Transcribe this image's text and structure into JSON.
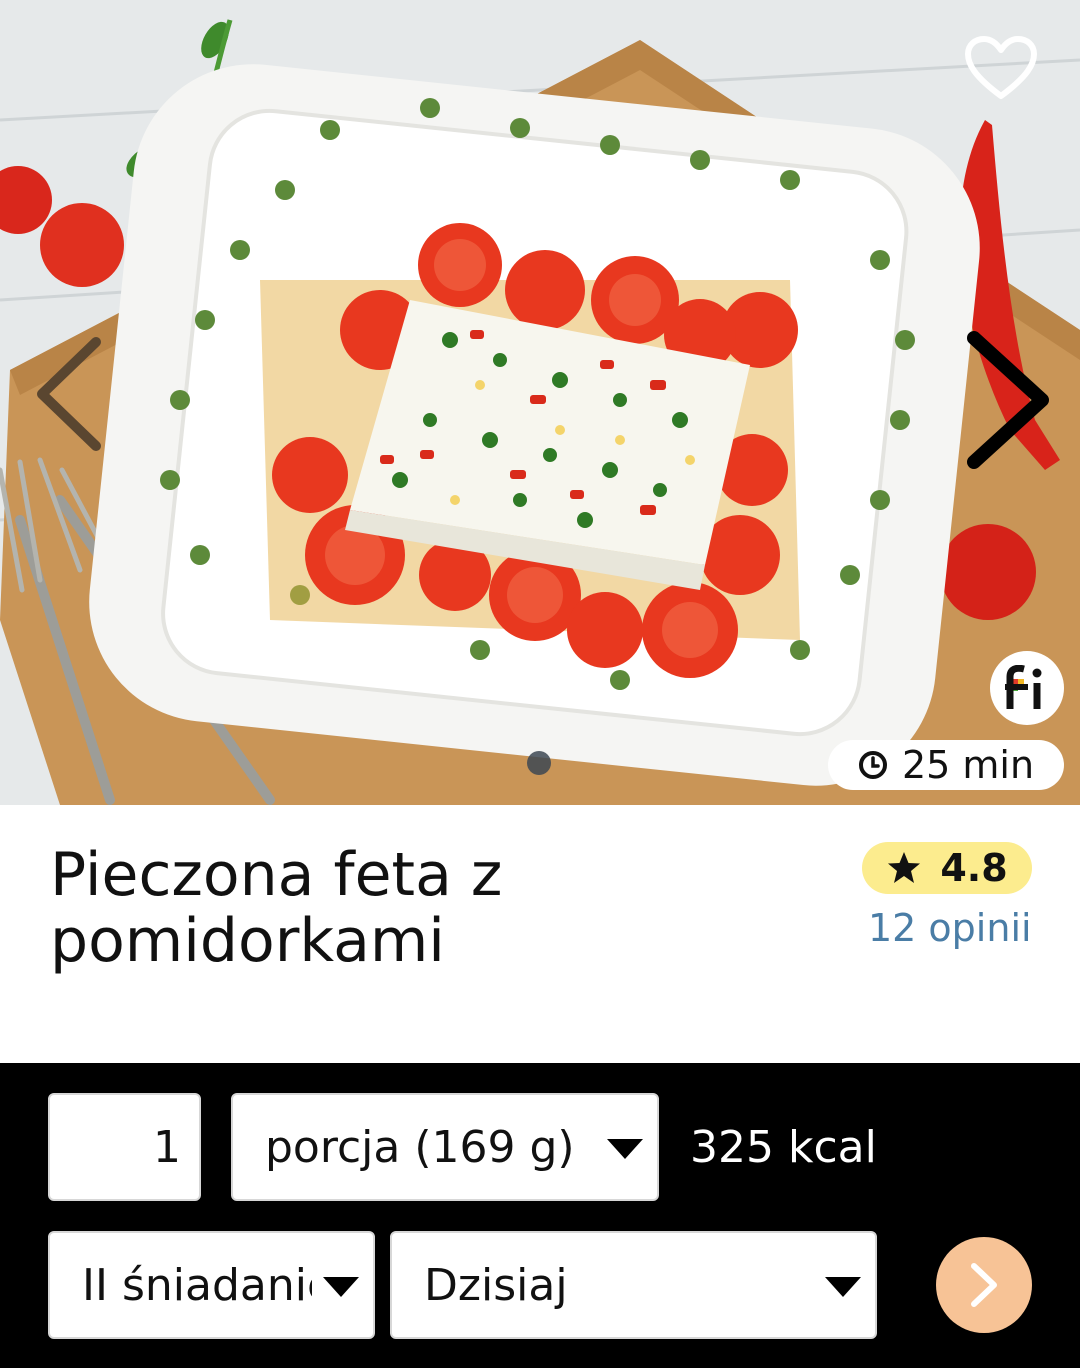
{
  "recipe": {
    "title": "Pieczona feta z pomidorkami",
    "time": "25 min",
    "rating": "4.8",
    "reviews": "12 opinii"
  },
  "gallery": {
    "icons": [
      "heart-outline-icon",
      "chevron-left-icon",
      "chevron-right-icon",
      "clock-icon",
      "fitatu-logo"
    ],
    "active_dot": 1,
    "photo_alt": "baked feta with cherry tomatoes"
  },
  "entry": {
    "quantity": "1",
    "unit": "porcja (169 g)",
    "kcal": "325 kcal",
    "meal": "II śniadanie",
    "day": "Dzisiaj"
  },
  "colors": {
    "rating_bg": "#fcec8e",
    "reviews_link": "#4a7da6",
    "confirm_button": "#f7c396",
    "panel_bg": "#000000"
  }
}
